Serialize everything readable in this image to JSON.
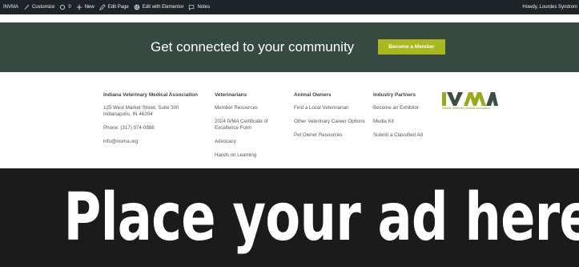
{
  "admin_bar": {
    "site_name": "INVMA",
    "customize": "Customize",
    "comments_count": "0",
    "new": "New",
    "edit_page": "Edit Page",
    "edit_elementor": "Edit with Elementor",
    "notes": "Notes",
    "howdy": "Howdy, Lourdes Syndrom"
  },
  "cta": {
    "title": "Get connected to your community",
    "button_label": "Become a Member"
  },
  "footer": {
    "org": {
      "name": "Indiana Veterinary Medical Association",
      "address_line1": "125 West Market Street, Suite 300",
      "address_line2": "Indianapolis, IN 46204",
      "phone": "Phone: (317) 974-0888",
      "email": "info@invma.org"
    },
    "veterinarians": {
      "heading": "Veterinarians",
      "links": [
        "Member Resources",
        "2024 IVMA Certificate of Excellence Form",
        "Advocacy",
        "Hands on Learning"
      ]
    },
    "animal_owners": {
      "heading": "Animal Owners",
      "links": [
        "Find a Local Veterinarian",
        "Other Veterinary Career Options",
        "Pet Owner Resources"
      ]
    },
    "industry_partners": {
      "heading": "Industry Partners",
      "links": [
        "Become an Exhibitor",
        "Media Kit",
        "Submit a Classified Ad"
      ]
    },
    "logo_tagline": "Indiana Veterinary Medical Association"
  },
  "ad": {
    "text": "Place your ad here!"
  },
  "colors": {
    "admin_bar": "#1d2327",
    "cta_bg": "#364a42",
    "accent": "#a8b81d",
    "ad_bg": "#1b1b1b"
  }
}
